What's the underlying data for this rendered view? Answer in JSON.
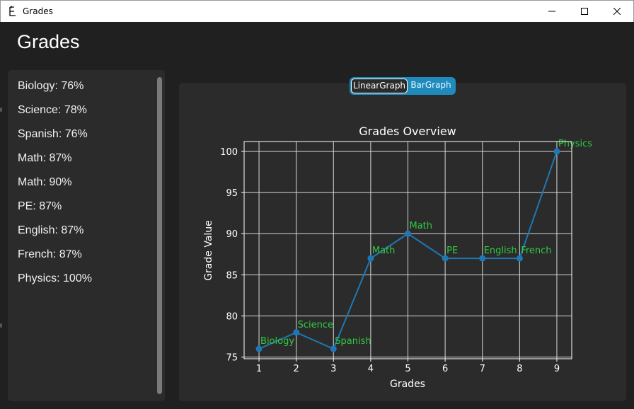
{
  "window": {
    "title": "Grades"
  },
  "app": {
    "title": "Grades"
  },
  "sidebar": {
    "items": [
      {
        "label": "Biology: 76%"
      },
      {
        "label": "Science: 78%"
      },
      {
        "label": "Spanish: 76%"
      },
      {
        "label": "Math: 87%"
      },
      {
        "label": "Math: 90%"
      },
      {
        "label": "PE: 87%"
      },
      {
        "label": "English: 87%"
      },
      {
        "label": "French: 87%"
      },
      {
        "label": "Physics: 100%"
      }
    ]
  },
  "toggle": {
    "linear_label": "LinearGraph",
    "bar_label": "BarGraph",
    "selected": "LinearGraph"
  },
  "colors": {
    "line": "#1f77b4",
    "annotation": "#2ecc40",
    "accent": "#1f8bbd",
    "background": "#202020",
    "panel": "#2b2b2b"
  },
  "chart_data": {
    "type": "line",
    "title": "Grades Overview",
    "xlabel": "Grades",
    "ylabel": "Grade Value",
    "x": [
      1,
      2,
      3,
      4,
      5,
      6,
      7,
      8,
      9
    ],
    "y": [
      76,
      78,
      76,
      87,
      90,
      87,
      87,
      87,
      100
    ],
    "point_labels": [
      "Biology",
      "Science",
      "Spanish",
      "Math",
      "Math",
      "PE",
      "English",
      "French",
      "Physics"
    ],
    "xticks": [
      1,
      2,
      3,
      4,
      5,
      6,
      7,
      8,
      9
    ],
    "yticks": [
      75,
      80,
      85,
      90,
      95,
      100
    ],
    "xlim": [
      0.6,
      9.4
    ],
    "ylim": [
      74.8,
      101.2
    ],
    "grid": true,
    "markers": "circle"
  }
}
